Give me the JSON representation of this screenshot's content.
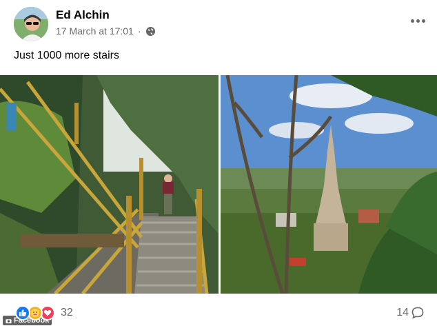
{
  "post": {
    "author": "Ed Alchin",
    "date": "17 March at 17:01",
    "separator": "·",
    "caption": "Just 1000 more stairs"
  },
  "reactions": {
    "count": "32",
    "types": [
      "like-icon",
      "care-icon",
      "love-icon"
    ]
  },
  "comments": {
    "count": "14"
  },
  "source_badge": {
    "label": "Facebook"
  },
  "colors": {
    "like": "#1877f2",
    "care": "#f7b125",
    "love": "#f33e58",
    "secondary_text": "#65676b"
  }
}
